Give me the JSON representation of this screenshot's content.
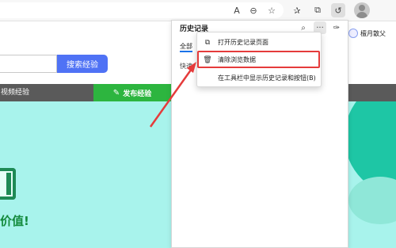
{
  "toolbar": {
    "icons": [
      "read-aloud-icon",
      "zoom-out-icon",
      "favorite-add-icon",
      "favorites-icon",
      "collections-icon",
      "history-icon",
      "profile-icon"
    ],
    "read_aloud_glyph": "A",
    "zoom_glyph": "⊖",
    "fav_add_glyph": "☆",
    "favorites_glyph": "✰",
    "collections_glyph": "⧉",
    "history_glyph": "↺"
  },
  "page": {
    "search_button_label": "搜索经验",
    "nav_video_label": "视频经验",
    "nav_publish_label": "发布经验",
    "publish_icon_glyph": "✎",
    "banner_text": "价值!",
    "user_nickname": "檀月散父"
  },
  "history_panel": {
    "title": "历史记录",
    "search_glyph": "⌕",
    "more_glyph": "···",
    "pin_glyph": "✑",
    "tab_all": "全部",
    "quick_label": "快速",
    "accent_color": "#1a73e8"
  },
  "menu": {
    "items": [
      {
        "label": "打开历史记录页面",
        "icon_glyph": "⧉"
      },
      {
        "label": "清除浏览数据",
        "icon_glyph": "🗑"
      },
      {
        "label": "在工具栏中显示历史记录和按钮(B)",
        "icon_glyph": ""
      }
    ],
    "highlight_color": "#e53b3b"
  }
}
